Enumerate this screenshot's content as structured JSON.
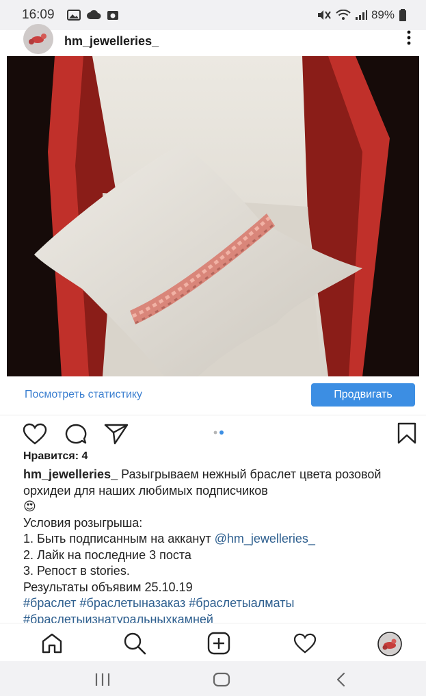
{
  "status_bar": {
    "time": "16:09",
    "battery": "89%"
  },
  "post": {
    "username": "hm_jewelleries_",
    "view_stats_label": "Посмотреть статистику",
    "promote_label": "Продвигать",
    "likes": "Нравится: 4",
    "caption": {
      "username": "hm_jewelleries_",
      "text": " Разыгрываем нежный браслет цвета розовой орхидеи для наших любимых подписчиков",
      "emoji": "😍",
      "conditions_title": "Условия розыгрыша:",
      "rule1_prefix": "1. Быть подписанным на акканут ",
      "rule1_mention": "@hm_jewelleries_",
      "rule2": "2. Лайк на последние 3 поста",
      "rule3": "3. Репост в stories.",
      "results": "Результаты объявим 25.10.19",
      "hashtags1": "#браслет #браслетыназаказ #браслетыалматы",
      "hashtags2": "#браслетыизнатуральныхкамней"
    }
  },
  "colors": {
    "accent": "#3c8ee3",
    "link": "#3b7fd0"
  }
}
